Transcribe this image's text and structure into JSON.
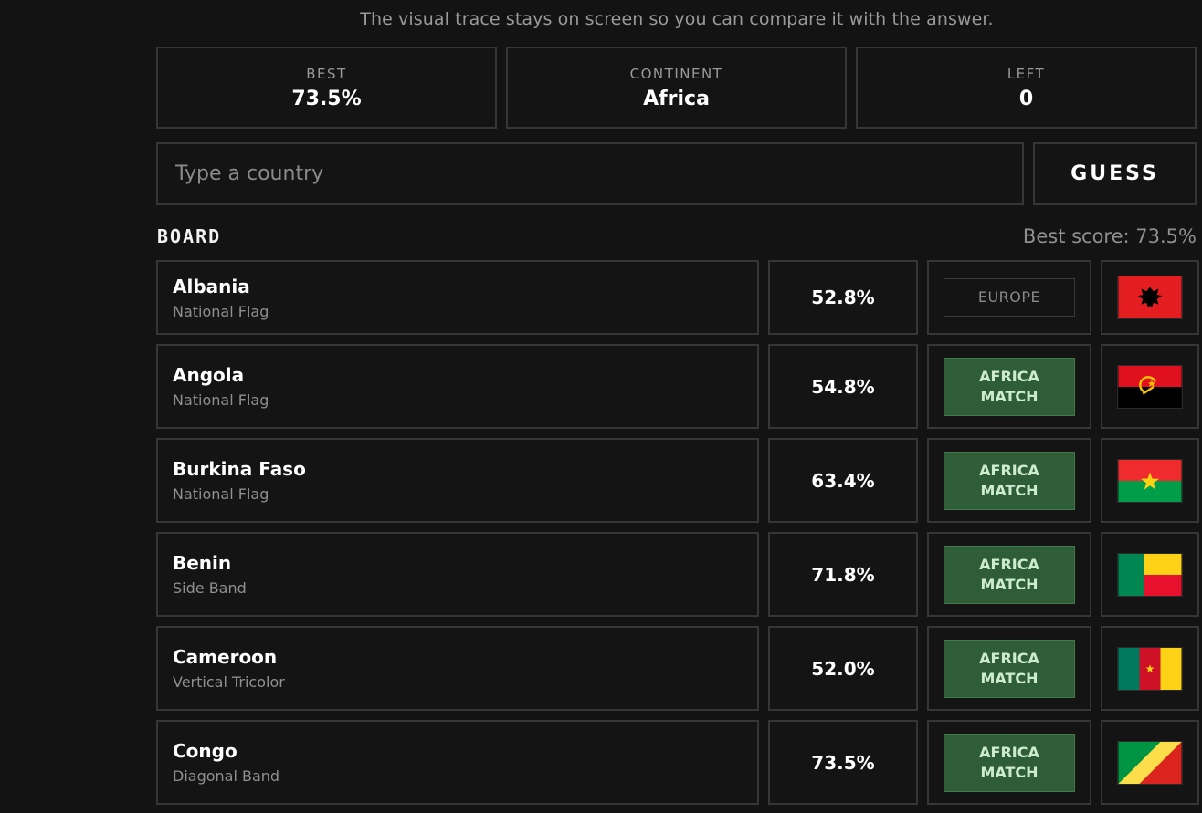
{
  "header": {
    "subtitle": "The visual trace stays on screen so you can compare it with the answer."
  },
  "stats": [
    {
      "label": "BEST",
      "value": "73.5%"
    },
    {
      "label": "CONTINENT",
      "value": "Africa"
    },
    {
      "label": "LEFT",
      "value": "0"
    }
  ],
  "guess": {
    "placeholder": "Type a country",
    "value": "",
    "button_label": "GUESS"
  },
  "board": {
    "title": "BOARD",
    "best_score": "Best score: 73.5%",
    "rows": [
      {
        "country": "Albania",
        "kind": "National Flag",
        "score": "52.8%",
        "continent": "EUROPE",
        "match": "",
        "status": "miss",
        "flag": "albania-flag"
      },
      {
        "country": "Angola",
        "kind": "National Flag",
        "score": "54.8%",
        "continent": "AFRICA",
        "match": "MATCH",
        "status": "match",
        "flag": "angola-flag"
      },
      {
        "country": "Burkina Faso",
        "kind": "National Flag",
        "score": "63.4%",
        "continent": "AFRICA",
        "match": "MATCH",
        "status": "match",
        "flag": "burkina-faso-flag"
      },
      {
        "country": "Benin",
        "kind": "Side Band",
        "score": "71.8%",
        "continent": "AFRICA",
        "match": "MATCH",
        "status": "match",
        "flag": "benin-flag"
      },
      {
        "country": "Cameroon",
        "kind": "Vertical Tricolor",
        "score": "52.0%",
        "continent": "AFRICA",
        "match": "MATCH",
        "status": "match",
        "flag": "cameroon-flag"
      },
      {
        "country": "Congo",
        "kind": "Diagonal Band",
        "score": "73.5%",
        "continent": "AFRICA",
        "match": "MATCH",
        "status": "match",
        "flag": "congo-flag"
      }
    ]
  },
  "colors": {
    "background": "#131313",
    "panel_border": "#363636",
    "match_green": "#2e5d37",
    "match_text": "#cdeccf"
  }
}
